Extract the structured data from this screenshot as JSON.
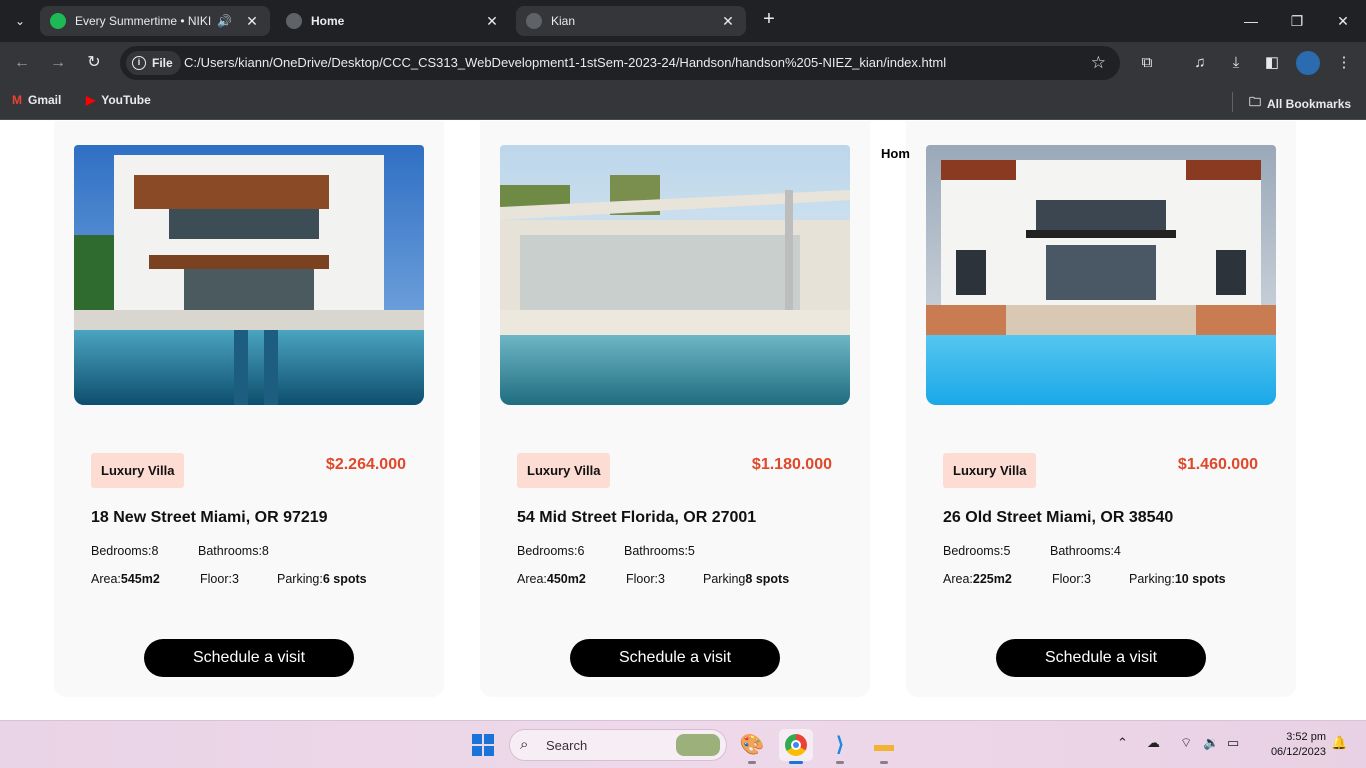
{
  "browser": {
    "tabs": [
      {
        "title": "Every Summertime • NIKI",
        "favicon": "spotify-icon",
        "audio": true
      },
      {
        "title": "Home",
        "favicon": "globe-icon"
      },
      {
        "title": "Kian",
        "favicon": "globe-icon",
        "active": true
      }
    ],
    "omnibox": {
      "chip_label": "File",
      "url": "C:/Users/kiann/OneDrive/Desktop/CCC_CS313_WebDevelopment1-1stSem-2023-24/Handson/handson%205-NIEZ_kian/index.html"
    },
    "bookmarks": [
      {
        "label": "Gmail",
        "icon": "gmail-icon"
      },
      {
        "label": "YouTube",
        "icon": "youtube-icon"
      }
    ],
    "all_bookmarks_label": "All Bookmarks"
  },
  "page": {
    "stray_nav_text": "Hom",
    "listings": [
      {
        "badge": "Luxury Villa",
        "price": "$2.264.000",
        "address": "18 New Street Miami, OR 97219",
        "bedrooms_label": "Bedrooms:",
        "bedrooms": "8",
        "bathrooms_label": "Bathrooms:",
        "bathrooms": "8",
        "area_label": "Area:",
        "area": "545m2",
        "floor_label": "Floor:",
        "floor": "3",
        "parking_label": "Parking:",
        "parking": "6 spots",
        "cta": "Schedule a visit"
      },
      {
        "badge": "Luxury Villa",
        "price": "$1.180.000",
        "address": "54 Mid Street Florida, OR 27001",
        "bedrooms_label": "Bedrooms:",
        "bedrooms": "6",
        "bathrooms_label": "Bathrooms:",
        "bathrooms": "5",
        "area_label": "Area:",
        "area": "450m2",
        "floor_label": "Floor:",
        "floor": "3",
        "parking_label": "Parking",
        "parking": "8 spots",
        "cta": "Schedule a visit"
      },
      {
        "badge": "Luxury Villa",
        "price": "$1.460.000",
        "address": "26 Old Street Miami, OR 38540",
        "bedrooms_label": "Bedrooms:",
        "bedrooms": "5",
        "bathrooms_label": "Bathrooms:",
        "bathrooms": "4",
        "area_label": "Area:",
        "area": "225m2",
        "floor_label": "Floor:",
        "floor": "3",
        "parking_label": "Parking:",
        "parking": "10 spots",
        "cta": "Schedule a visit"
      }
    ]
  },
  "taskbar": {
    "search_placeholder": "Search",
    "time": "3:52 pm",
    "date": "06/12/2023"
  },
  "colors": {
    "price": "#e0482b",
    "badge_bg": "#fcdcd3",
    "cta_bg": "#000000",
    "card_bg": "#f9f9f9"
  }
}
